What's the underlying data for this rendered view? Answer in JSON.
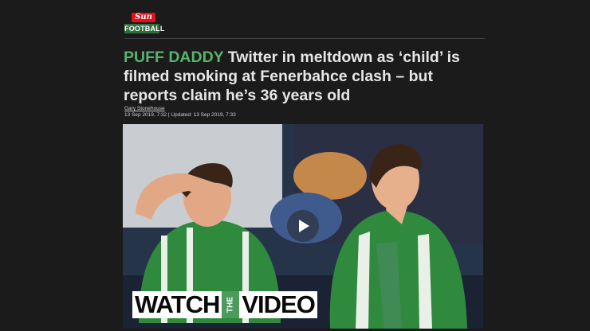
{
  "brand": {
    "logo_top": "Sun",
    "logo_bottom": "FOOTBALL"
  },
  "article": {
    "kicker": "PUFF DADDY",
    "headline": "Twitter in meltdown as ‘child’ is filmed smoking at Fenerbahce clash – but reports claim he’s 36 years old",
    "author": "Gary Stonehouse",
    "dates": "13 Sep 2019, 7:32 | Updated: 13 Sep 2019, 7:33"
  },
  "video": {
    "overlay_word1": "WATCH",
    "overlay_word2": "THE",
    "overlay_word3": "VIDEO",
    "play_icon": "play-icon",
    "colors": {
      "jersey_green": "#2f8a3e",
      "overlay_green": "#4c9a5c",
      "background": "#1b1b1b"
    }
  }
}
